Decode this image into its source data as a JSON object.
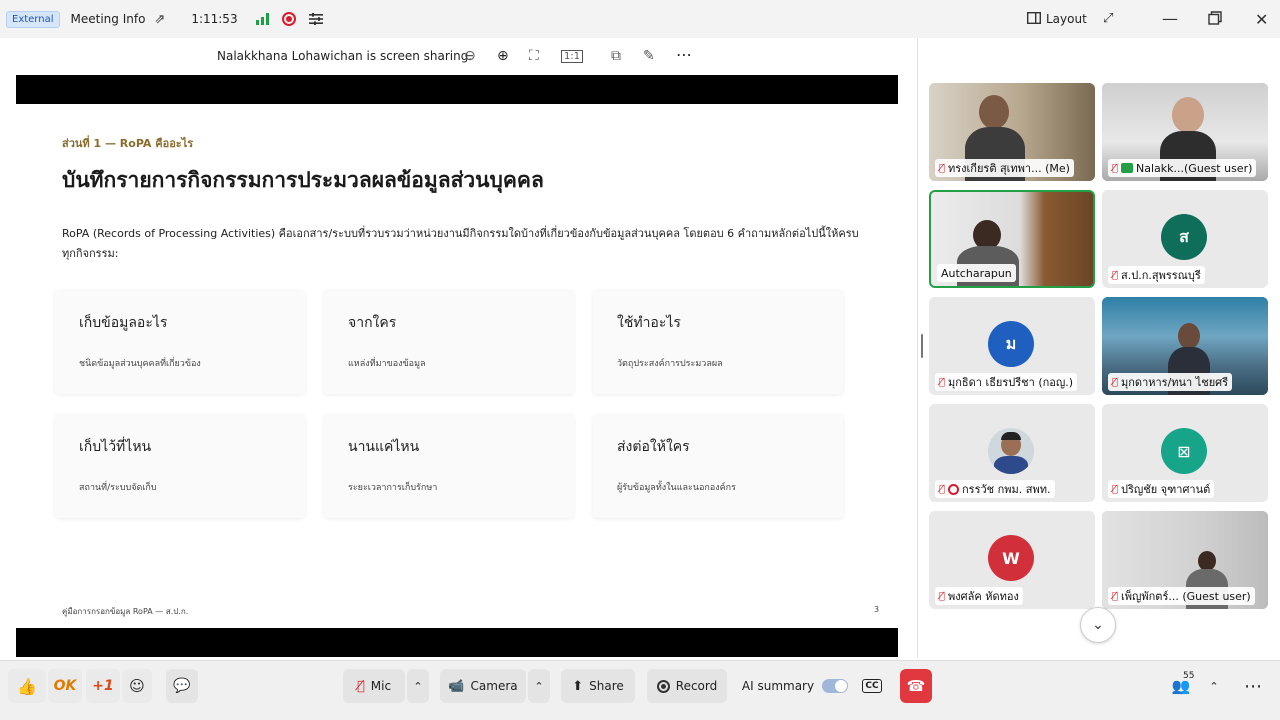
{
  "topbar": {
    "external_tag": "External",
    "meeting_info": "Meeting Info",
    "timer": "1:11:53",
    "layout_label": "Layout"
  },
  "sharebar": {
    "sharing_text": "Nalakkhana Lohawichan is screen sharing."
  },
  "slide": {
    "kicker": "ส่วนที่ 1 — RoPA คืออะไร",
    "title": "บันทึกรายการกิจกรรมการประมวลผลข้อมูลส่วนบุคคล",
    "body": "RoPA (Records of Processing Activities) คือเอกสาร/ระบบที่รวบรวมว่าหน่วยงานมีกิจกรรมใดบ้างที่เกี่ยวข้องกับข้อมูลส่วนบุคคล โดยตอบ 6 คำถามหลักต่อไปนี้ให้ครบทุกกิจกรรม:",
    "cards": [
      {
        "title": "เก็บข้อมูลอะไร",
        "desc": "ชนิดข้อมูลส่วนบุคคลที่เกี่ยวข้อง"
      },
      {
        "title": "จากใคร",
        "desc": "แหล่งที่มาของข้อมูล"
      },
      {
        "title": "ใช้ทำอะไร",
        "desc": "วัตถุประสงค์การประมวลผล"
      },
      {
        "title": "เก็บไว้ที่ไหน",
        "desc": "สถานที่/ระบบจัดเก็บ"
      },
      {
        "title": "นานแค่ไหน",
        "desc": "ระยะเวลาการเก็บรักษา"
      },
      {
        "title": "ส่งต่อให้ใคร",
        "desc": "ผู้รับข้อมูลทั้งในและนอกองค์กร"
      }
    ],
    "footer": "คู่มือการกรอกข้อมูล RoPA — ส.ป.ก.",
    "page_number": "3"
  },
  "participants": [
    {
      "name": "ทรงเกียรติ สุเทพา... (Me)",
      "type": "video",
      "muted": true
    },
    {
      "name": "Nalakk...(Guest user)",
      "type": "video",
      "muted": true,
      "sharing": true
    },
    {
      "name": "Autcharapun",
      "type": "video",
      "muted": false,
      "active": true
    },
    {
      "name": "ส.ป.ก.สุพรรณบุรี",
      "type": "avatar",
      "initial": "ส",
      "color": "#0f6e5a",
      "muted": true
    },
    {
      "name": "มุกธิดา เธียรปรีชา (กอญ.)",
      "type": "avatar",
      "initial": "ม",
      "color": "#1f5fbf",
      "muted": true
    },
    {
      "name": "มุกดาหาร/ทนา ไชยศรี",
      "type": "video",
      "muted": true
    },
    {
      "name": "กรรวัช กพม. สพท.",
      "type": "photo",
      "muted": true,
      "recording": true
    },
    {
      "name": "ปริญชัย จุฑาศานต์",
      "type": "avatar",
      "initial": "⊠",
      "color": "#17a58a",
      "muted": true
    },
    {
      "name": "พงศลัค หัดทอง",
      "type": "avatar",
      "initial": "W",
      "color": "#d12f3a",
      "muted": true
    },
    {
      "name": "เพ็ญพักตร์... (Guest user)",
      "type": "video",
      "muted": true
    }
  ],
  "toolbar": {
    "ok_label": "OK",
    "plus1_label": "+1",
    "mic_label": "Mic",
    "camera_label": "Camera",
    "share_label": "Share",
    "record_label": "Record",
    "ai_summary_label": "AI summary",
    "cc_label": "CC",
    "participant_count": "55"
  },
  "colors": {
    "active_speaker": "#23a045",
    "record_red": "#d81b2c",
    "hangup_red": "#e0383e"
  }
}
